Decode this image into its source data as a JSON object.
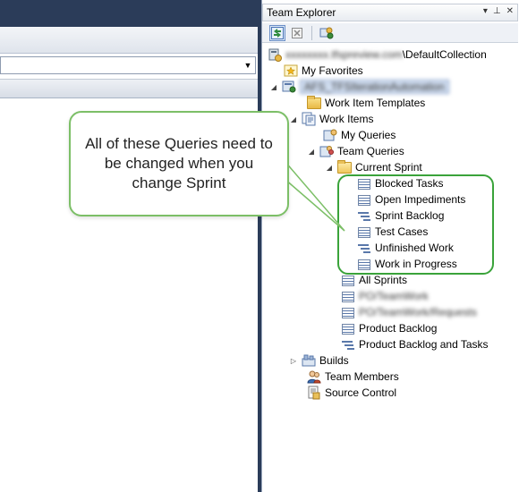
{
  "team_explorer": {
    "title": "Team Explorer",
    "title_buttons": [
      "▾",
      "⊥",
      "✕"
    ],
    "toolbar": {
      "refresh": "refresh-icon",
      "stop": "stop-icon",
      "connect": "connect-team-project-icon"
    },
    "tree": {
      "server": "\\DefaultCollection",
      "server_blurred": "xxxxxxxx.tfspreview.com",
      "my_favorites": "My Favorites",
      "project_blurred": "AFS_TFSIterationAutomation",
      "work_item_templates": "Work Item Templates",
      "work_items": "Work Items",
      "my_queries": "My Queries",
      "team_queries": "Team Queries",
      "current_sprint": "Current Sprint",
      "sprint_queries": [
        {
          "label": "Blocked Tasks",
          "icon": "flat-query-icon"
        },
        {
          "label": "Open Impediments",
          "icon": "flat-query-icon"
        },
        {
          "label": "Sprint Backlog",
          "icon": "tree-query-icon"
        },
        {
          "label": "Test Cases",
          "icon": "flat-query-icon"
        },
        {
          "label": "Unfinished Work",
          "icon": "tree-query-icon"
        },
        {
          "label": "Work in Progress",
          "icon": "flat-query-icon"
        }
      ],
      "all_sprints": "All Sprints",
      "blurred_1": "PO/TeamWork",
      "blurred_2": "PO/TeamWork/Requests",
      "product_backlog": "Product Backlog",
      "product_backlog_tasks": "Product Backlog and Tasks",
      "builds": "Builds",
      "team_members": "Team Members",
      "source_control": "Source Control"
    }
  },
  "callout": {
    "text": "All of these Queries need to be changed when you change Sprint"
  },
  "colors": {
    "callout_border": "#7cbf67",
    "highlight_border": "#3aa33a",
    "ide_dark": "#2b3c59"
  }
}
